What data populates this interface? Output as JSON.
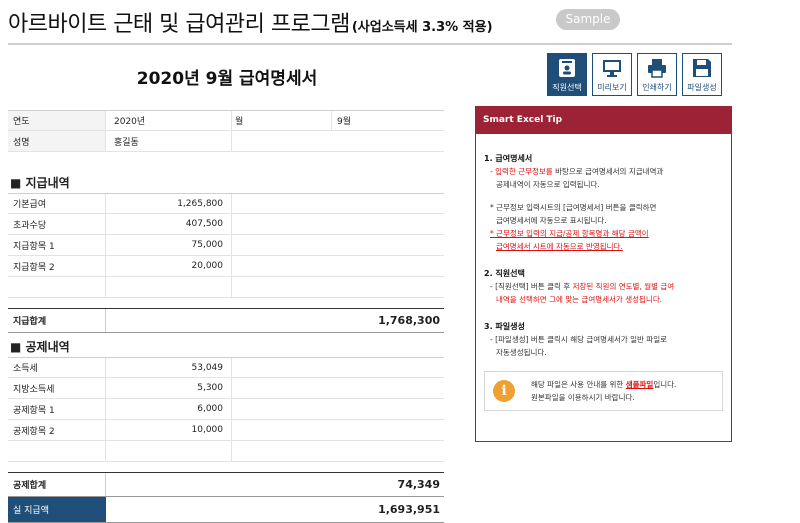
{
  "header": {
    "title": "아르바이트 근태 및 급여관리 프로그램",
    "subtitle": "(사업소득세 3.3% 적용)",
    "badge": "Sample"
  },
  "doc_title": "2020년 9월 급여명세서",
  "toolbar": [
    {
      "label": "직원선택",
      "icon": "employee-card-icon",
      "active": true
    },
    {
      "label": "미리보기",
      "icon": "monitor-icon",
      "active": false
    },
    {
      "label": "인쇄하기",
      "icon": "printer-icon",
      "active": false
    },
    {
      "label": "파일생성",
      "icon": "floppy-disk-icon",
      "active": false
    }
  ],
  "info": {
    "year_label": "연도",
    "year_value": "2020년",
    "month_label": "월",
    "month_value": "9월",
    "name_label": "성명",
    "name_value": "홍길동"
  },
  "payments": {
    "section_title": "■ 지급내역",
    "items": [
      {
        "label": "기본급여",
        "value": "1,265,800"
      },
      {
        "label": "초과수당",
        "value": "407,500"
      },
      {
        "label": "지급항목 1",
        "value": "75,000"
      },
      {
        "label": "지급항목 2",
        "value": "20,000"
      },
      {
        "label": "",
        "value": ""
      }
    ],
    "total_label": "지급합계",
    "total_value": "1,768,300"
  },
  "deductions": {
    "section_title": "■ 공제내역",
    "items": [
      {
        "label": "소득세",
        "value": "53,049"
      },
      {
        "label": "지방소득세",
        "value": "5,300"
      },
      {
        "label": "공제항목 1",
        "value": "6,000"
      },
      {
        "label": "공제항목 2",
        "value": "10,000"
      },
      {
        "label": "",
        "value": ""
      }
    ],
    "total_label": "공제합계",
    "total_value": "74,349"
  },
  "net": {
    "label": "실 지급액",
    "value": "1,693,951"
  },
  "tip": {
    "title": "Smart Excel Tip",
    "s1_head": "1. 급여명세서",
    "s1_red": "- 입력한 근무정보를",
    "s1_text1": " 바탕으로 급여명세서의 지급내역과",
    "s1_text2": "공제내역이 자동으로 입력됩니다.",
    "s1_b1": "* 근무정보 입력시트의 [급여명세서] 버튼을 클릭하면",
    "s1_b2": "급여명세서에 자동으로 표시됩니다.",
    "s1_r1": "* 근무정보 입력의 지급/공제 항목명과 해당 금액이",
    "s1_r2": "급여명세서 시트에 자동으로 반영됩니다.",
    "s2_head": "2. 직원선택",
    "s2_t1": "- [직원선택] 버튼 클릭 후 ",
    "s2_r1": "저장된 직원의 연도별, 월별 급여",
    "s2_r2": "내역을 선택하면 그에 맞는 급여명세서가 생성됩니다.",
    "s3_head": "3. 파일생성",
    "s3_t1": "- [파일생성] 버튼 클릭시 해당 급여명세서가 일반 파일로",
    "s3_t2": "자동생성됩니다.",
    "note_a": "해당 파일은 사용 안내를 위한 ",
    "note_link": "샘플파일",
    "note_b": "입니다.",
    "note_c": "원본파일을 이용하시기 바랍니다."
  }
}
